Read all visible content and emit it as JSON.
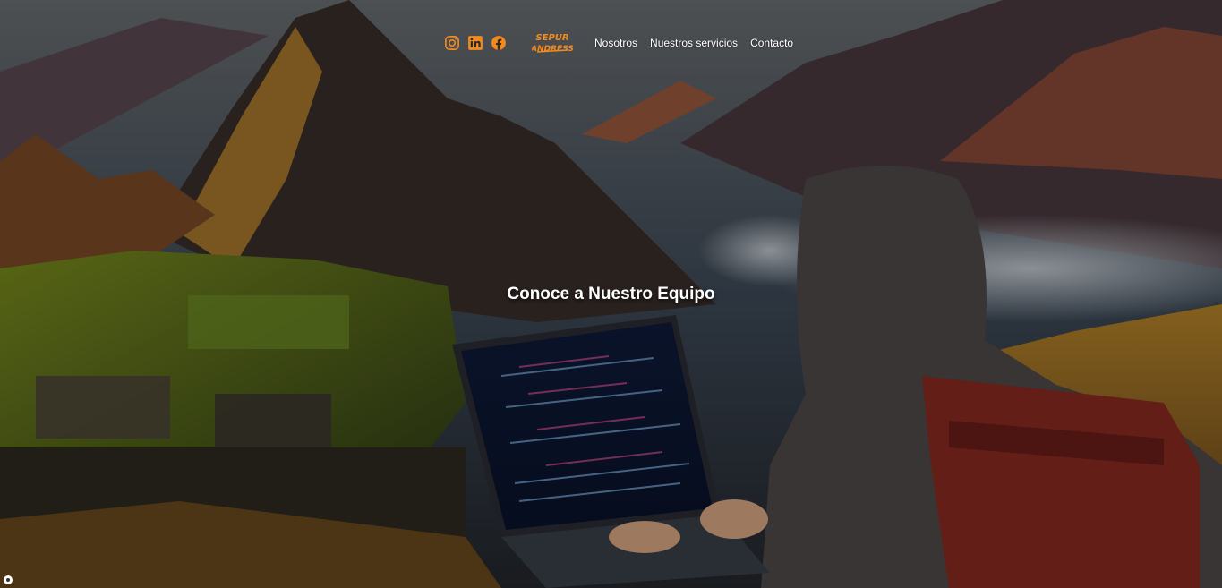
{
  "nav": {
    "social": [
      {
        "icon": "instagram-icon",
        "label": "Instagram"
      },
      {
        "icon": "linkedin-icon",
        "label": "LinkedIn"
      },
      {
        "icon": "facebook-icon",
        "label": "Facebook"
      }
    ],
    "logo_text_top": "SEPUR",
    "logo_text_bottom": "ANDRESS",
    "menu": [
      "Nosotros",
      "Nuestros servicios",
      "Contacto"
    ]
  },
  "hero": {
    "title": "Conoce a Nuestro Equipo",
    "background": "mountain-landscape-with-machu-picchu-ruins-and-hooded-person-coding-on-laptop"
  },
  "colors": {
    "accent": "#f28a1d",
    "text": "#ffffff"
  }
}
